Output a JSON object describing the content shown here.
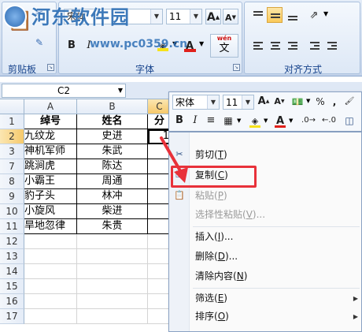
{
  "ribbon": {
    "font_name": "宋体",
    "font_size": "11",
    "grow_font": "A",
    "shrink_font": "A",
    "bold": "B",
    "italic": "I",
    "wen": "wén",
    "wen_char": "文",
    "clipboard_label": "剪贴板",
    "font_label": "字体",
    "alignment_label": "对齐方式"
  },
  "watermark": {
    "title": "河东软件园",
    "url": "www.pc0359.cn"
  },
  "formula_bar": {
    "name_box": "C2"
  },
  "grid": {
    "col_headers": [
      "A",
      "B",
      "C"
    ],
    "row_numbers": [
      "1",
      "2",
      "3",
      "7",
      "8",
      "9",
      "10",
      "11",
      "12",
      "13",
      "14",
      "15",
      "16",
      "17"
    ],
    "header_row": [
      "绰号",
      "姓名",
      "分"
    ],
    "rows": [
      {
        "a": "九纹龙",
        "b": "史进",
        "c": "1"
      },
      {
        "a": "神机军师",
        "b": "朱武",
        "c": ""
      },
      {
        "a": "跳涧虎",
        "b": "陈达",
        "c": ""
      },
      {
        "a": "小霸王",
        "b": "周通",
        "c": ""
      },
      {
        "a": "豹子头",
        "b": "林冲",
        "c": ""
      },
      {
        "a": "小旋风",
        "b": "柴进",
        "c": ""
      },
      {
        "a": "旱地忽律",
        "b": "朱贵",
        "c": ""
      }
    ]
  },
  "mini_toolbar": {
    "font_name": "宋体",
    "font_size": "11",
    "grow": "A",
    "shrink": "A",
    "percent": "%",
    "comma": ",",
    "bold": "B",
    "italic": "I"
  },
  "context_menu": {
    "items": [
      {
        "label": "剪切",
        "key": "T",
        "enabled": true
      },
      {
        "label": "复制",
        "key": "C",
        "enabled": true
      },
      {
        "label": "粘贴",
        "key": "P",
        "enabled": false
      },
      {
        "label": "选择性粘贴",
        "key": "V",
        "suffix": "...",
        "enabled": false
      },
      {
        "label": "插入",
        "key": "I",
        "suffix": "...",
        "enabled": true
      },
      {
        "label": "删除",
        "key": "D",
        "suffix": "...",
        "enabled": true
      },
      {
        "label": "清除内容",
        "key": "N",
        "enabled": true
      },
      {
        "label": "筛选",
        "key": "E",
        "enabled": true
      },
      {
        "label": "排序",
        "key": "O",
        "enabled": true
      }
    ]
  },
  "colors": {
    "highlight": "#e8313a",
    "ribbon_label": "#15428b",
    "font_color": "#e0201a",
    "fill_color": "#f6e21b"
  }
}
